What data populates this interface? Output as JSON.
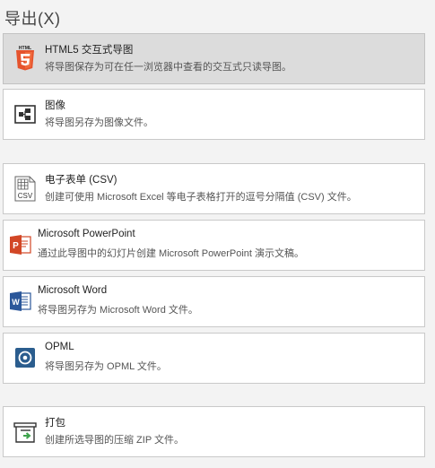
{
  "header": {
    "title": "导出(X)"
  },
  "options": [
    {
      "name": "HTML5 交互式导图",
      "desc": "将导图保存为可在任一浏览器中查看的交互式只读导图。",
      "icon": "html5-icon",
      "icon_text": "HTML"
    },
    {
      "name": "图像",
      "desc": "将导图另存为图像文件。",
      "icon": "image-export-icon"
    },
    {
      "name": "电子表单 (CSV)",
      "desc": "创建可使用 Microsoft Excel 等电子表格打开的逗号分隔值 (CSV) 文件。",
      "icon": "csv-icon",
      "icon_text": "CSV"
    },
    {
      "name": "Microsoft PowerPoint",
      "desc": "通过此导图中的幻灯片创建 Microsoft PowerPoint 演示文稿。",
      "icon": "powerpoint-icon",
      "icon_text": "P"
    },
    {
      "name": "Microsoft Word",
      "desc": "将导图另存为 Microsoft Word 文件。",
      "icon": "word-icon",
      "icon_text": "W"
    },
    {
      "name": "OPML",
      "desc": "将导图另存为 OPML 文件。",
      "icon": "opml-icon"
    },
    {
      "name": "打包",
      "desc": "创建所选导图的压缩 ZIP 文件。",
      "icon": "package-icon"
    }
  ],
  "colors": {
    "html5": "#e5532d",
    "powerpoint": "#d24726",
    "word": "#2b579a",
    "opml": "#2b5d8e",
    "package_arrow": "#3fa34d"
  }
}
